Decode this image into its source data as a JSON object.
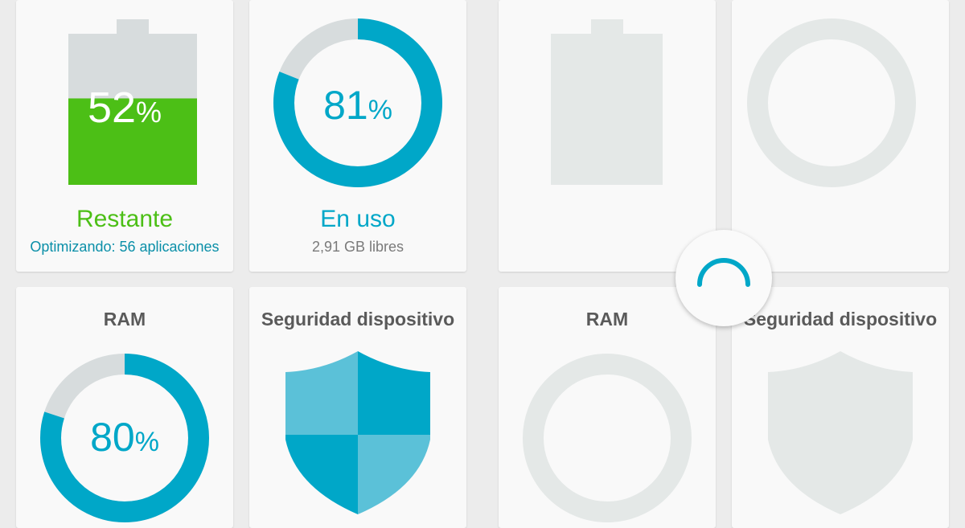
{
  "colors": {
    "accent": "#00a7c8",
    "battery_green": "#4cbf16",
    "track_gray": "#d7dcdd",
    "placeholder_gray": "#e4e8e7",
    "shield_light": "#5bc1d8",
    "text_gray": "#5a5a5a"
  },
  "battery": {
    "percent": 52,
    "value_text": "52",
    "percent_sign": "%",
    "label": "Restante",
    "sublabel": "Optimizando: 56 aplicaciones",
    "icon": "battery-icon"
  },
  "storage": {
    "percent": 81,
    "value_text": "81",
    "percent_sign": "%",
    "label": "En uso",
    "sublabel": "2,91 GB libres",
    "icon": "donut-gauge-icon"
  },
  "ram": {
    "title": "RAM",
    "percent": 80,
    "value_text": "80",
    "percent_sign": "%",
    "icon": "donut-gauge-icon"
  },
  "security": {
    "title": "Seguridad dispositivo",
    "icon": "shield-icon"
  },
  "placeholders": {
    "ram_title": "RAM",
    "security_title": "Seguridad dispositivo"
  },
  "spinner": {
    "icon": "loading-spinner-icon"
  }
}
